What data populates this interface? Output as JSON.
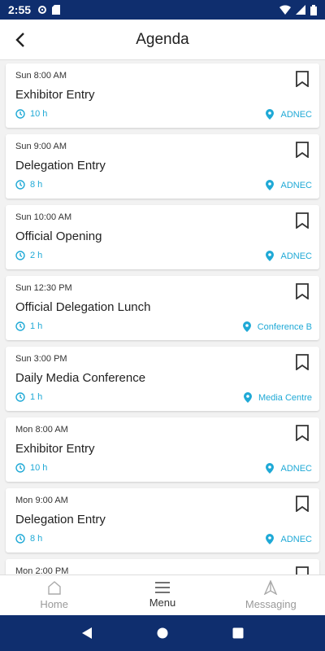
{
  "status_bar": {
    "time": "2:55"
  },
  "header": {
    "title": "Agenda"
  },
  "agenda": [
    {
      "time": "Sun 8:00 AM",
      "title": "Exhibitor Entry",
      "duration": "10 h",
      "location": "ADNEC"
    },
    {
      "time": "Sun 9:00 AM",
      "title": "Delegation Entry",
      "duration": "8 h",
      "location": "ADNEC"
    },
    {
      "time": "Sun 10:00 AM",
      "title": "Official Opening",
      "duration": "2 h",
      "location": "ADNEC"
    },
    {
      "time": "Sun 12:30 PM",
      "title": "Official Delegation Lunch",
      "duration": "1 h",
      "location": "Conference B"
    },
    {
      "time": "Sun 3:00 PM",
      "title": "Daily Media Conference",
      "duration": "1 h",
      "location": "Media Centre"
    },
    {
      "time": "Mon 8:00 AM",
      "title": "Exhibitor Entry",
      "duration": "10 h",
      "location": "ADNEC"
    },
    {
      "time": "Mon 9:00 AM",
      "title": "Delegation Entry",
      "duration": "8 h",
      "location": "ADNEC"
    }
  ],
  "partial_item": {
    "time": "Mon 2:00 PM"
  },
  "bottom_nav": {
    "home": "Home",
    "menu": "Menu",
    "messaging": "Messaging"
  },
  "colors": {
    "accent": "#1fa9d6",
    "system_bar": "#0f2e6e"
  },
  "icons": {
    "back": "arrow-left-icon",
    "bookmark": "bookmark-icon",
    "clock": "clock-icon",
    "location": "map-pin-icon",
    "home": "home-icon",
    "menu": "hamburger-icon",
    "messaging": "send-icon"
  }
}
